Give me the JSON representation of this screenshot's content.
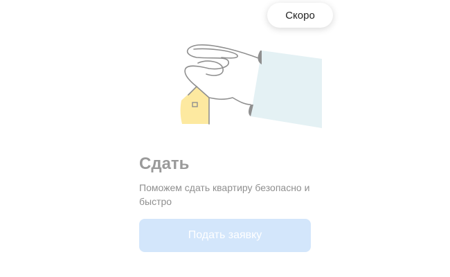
{
  "badge": {
    "label": "Скоро"
  },
  "illustration": {
    "icon": "hand-holding-house-icon"
  },
  "section": {
    "title": "Сдать",
    "subtitle": "Поможем сдать квартиру безопасно и быстро"
  },
  "action": {
    "label": "Подать заявку"
  },
  "colors": {
    "title": "#9a9a9a",
    "subtitle": "#8f8f8f",
    "button_bg": "#d3e6fb",
    "sleeve": "#e4f1f4",
    "house": "#fde9a0"
  }
}
